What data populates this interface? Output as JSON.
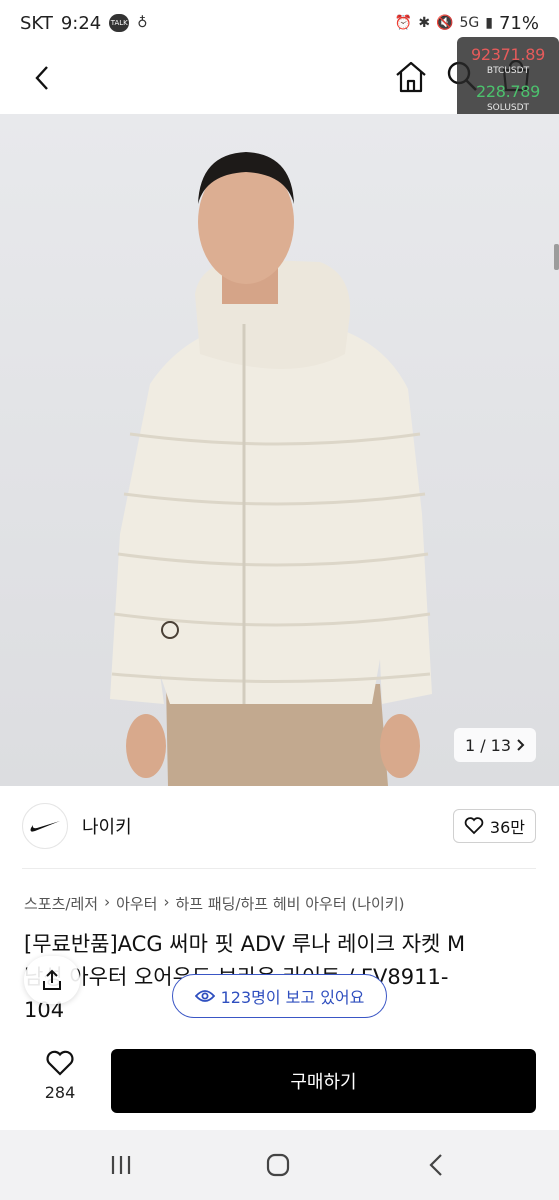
{
  "status_bar": {
    "carrier": "SKT",
    "time": "9:24",
    "talk_badge": "TALK",
    "network": "5G",
    "battery": "71%"
  },
  "ticker": [
    {
      "price": "92371.89",
      "symbol": "BTCUSDT",
      "direction": "down"
    },
    {
      "price": "228.789",
      "symbol": "SOLUSDT",
      "direction": "up"
    }
  ],
  "nav": {
    "icons": [
      "back-chevron-icon",
      "home-icon",
      "search-icon",
      "cart-icon"
    ]
  },
  "gallery": {
    "page_indicator": "1 / 13",
    "image_subject": "model wearing cream puffer jacket"
  },
  "brand": {
    "name": "나이키",
    "likes": "36만"
  },
  "breadcrumb": [
    "스포츠/레저",
    "아우터",
    "하프 패딩/하프 헤비 아우터 (나이키)"
  ],
  "product": {
    "title_line1": "[무료반품]ACG 써마 핏 ADV 루나 레이크 자켓 M",
    "title_line2": "남성 아우터 오어우드 브라운 라이트 / FV8911-",
    "title_line3": "104"
  },
  "viewers": {
    "label": "123명이 보고 있어요"
  },
  "bottom_bar": {
    "favorite_count": "284",
    "buy_label": "구매하기"
  },
  "colors": {
    "accent_blue": "#2f4fbf",
    "buy_button": "#000000",
    "ticker_down": "#e65b5b",
    "ticker_up": "#4cc26d"
  }
}
